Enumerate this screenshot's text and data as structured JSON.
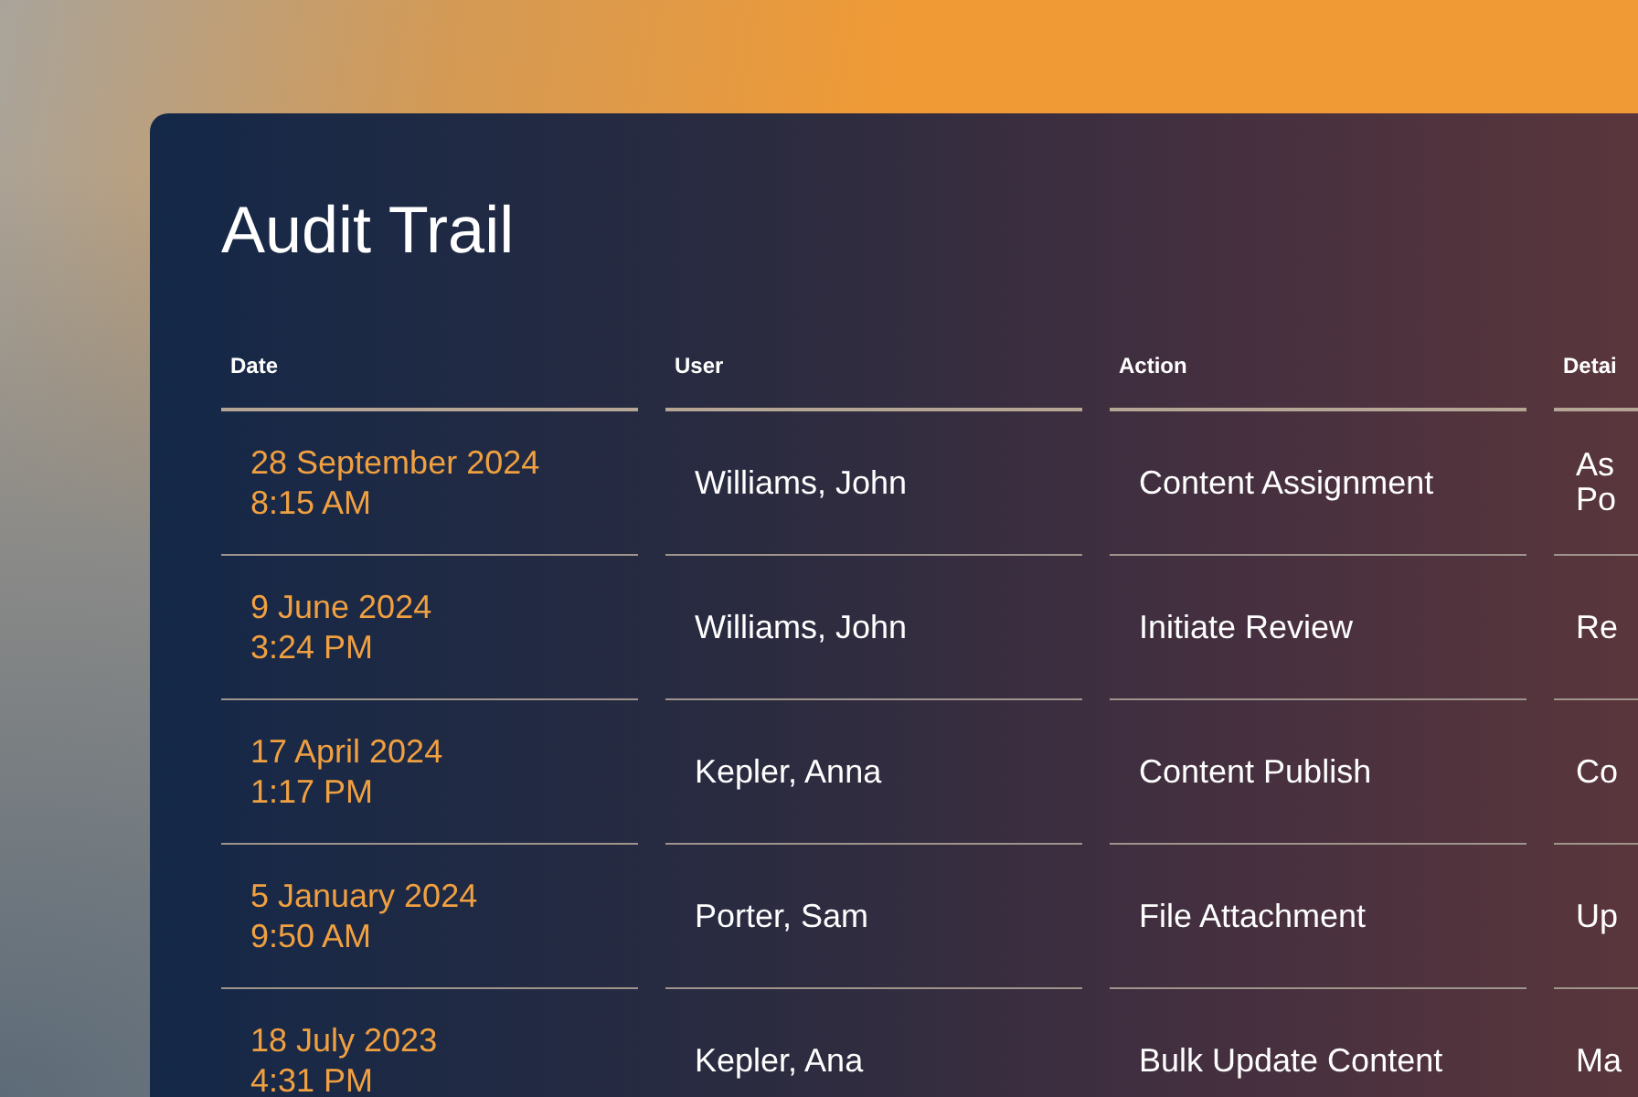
{
  "title": "Audit Trail",
  "columns": [
    "Date",
    "User",
    "Action",
    "Detai"
  ],
  "rows": [
    {
      "date": "28 September 2024",
      "time": "8:15 AM",
      "user": "Williams, John",
      "action": "Content Assignment",
      "detail": "As Po"
    },
    {
      "date": "9 June 2024",
      "time": "3:24 PM",
      "user": "Williams, John",
      "action": "Initiate Review",
      "detail": "Re"
    },
    {
      "date": "17 April 2024",
      "time": "1:17 PM",
      "user": "Kepler, Anna",
      "action": "Content Publish",
      "detail": "Co"
    },
    {
      "date": "5 January 2024",
      "time": "9:50 AM",
      "user": "Porter, Sam",
      "action": "File Attachment",
      "detail": "Up"
    },
    {
      "date": "18 July 2023",
      "time": "4:31 PM",
      "user": "Kepler, Ana",
      "action": "Bulk Update Content",
      "detail": "Ma"
    }
  ]
}
